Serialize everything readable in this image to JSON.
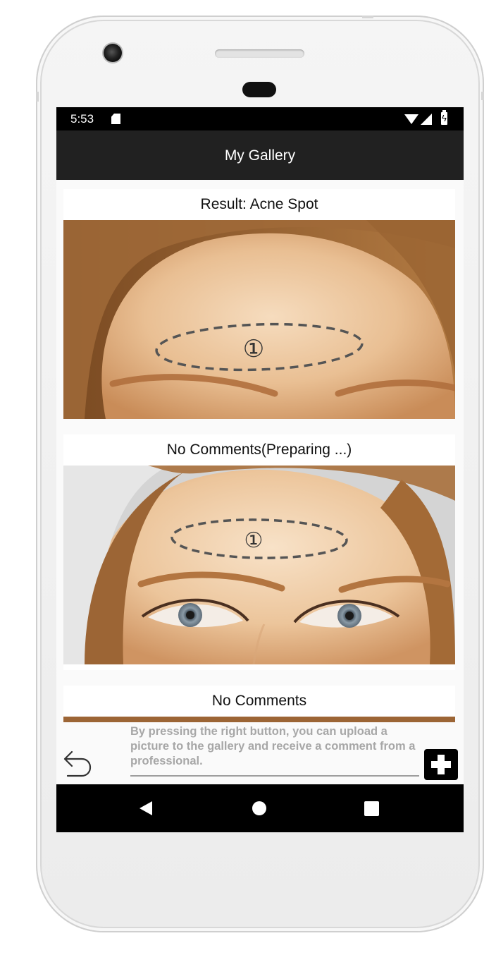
{
  "status_bar": {
    "time": "5:53",
    "icons": [
      "sd-card-icon",
      "wifi-icon",
      "signal-icon",
      "battery-charging-icon"
    ]
  },
  "app_bar": {
    "title": "My Gallery"
  },
  "gallery": [
    {
      "title": "Result: Acne Spot",
      "marker": "①"
    },
    {
      "title": "No Comments(Preparing ...)",
      "marker": "①"
    },
    {
      "title": "No Comments"
    }
  ],
  "bottom_bar": {
    "hint_text": "By pressing the right button, you can upload a picture to the gallery and receive a comment from a professional.",
    "back_icon": "undo-arrow-icon",
    "add_icon": "plus-icon"
  },
  "nav_bar": {
    "icons": [
      "nav-back-icon",
      "nav-home-icon",
      "nav-recents-icon"
    ]
  },
  "colors": {
    "app_bar": "#212121",
    "status_bar": "#000000",
    "hint_text": "#a7a7a7",
    "skin": "#e3b88a",
    "hair": "#9c6535"
  }
}
